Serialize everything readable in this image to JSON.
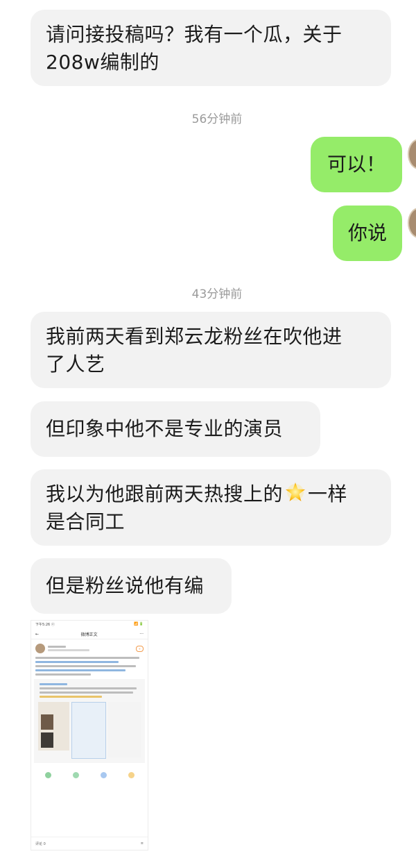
{
  "messages": [
    {
      "side": "left",
      "text_line1": "请问接投稿吗？我有一个瓜，关于",
      "text_line2": "208w编制的"
    },
    {
      "side": "time",
      "text": "56分钟前"
    },
    {
      "side": "right",
      "text": "可以！"
    },
    {
      "side": "right",
      "text": "你说"
    },
    {
      "side": "time",
      "text": "43分钟前"
    },
    {
      "side": "left",
      "text_line1": "我前两天看到郑云龙粉丝在吹他进",
      "text_line2": "了人艺"
    },
    {
      "side": "left",
      "text_line1": "但印象中他不是专业的演员"
    },
    {
      "side": "left",
      "text_before_emoji": "我以为他跟前两天热搜上的",
      "emoji": "star-emoji",
      "text_after_emoji": "一样",
      "text_line2": "是合同工"
    },
    {
      "side": "left",
      "text_line1": "但是粉丝说他有编"
    },
    {
      "side": "image",
      "description_icon": "weibo-screenshot-thumbnail",
      "status_left": "下午5:26 ⓔ",
      "status_right": "📶 🔋",
      "nav_title": "微博正文",
      "comment_tab": "评论 0"
    }
  ],
  "colors": {
    "left_bubble": "#f2f2f2",
    "right_bubble": "#95ec69",
    "timestamp": "#9a9a9a"
  }
}
